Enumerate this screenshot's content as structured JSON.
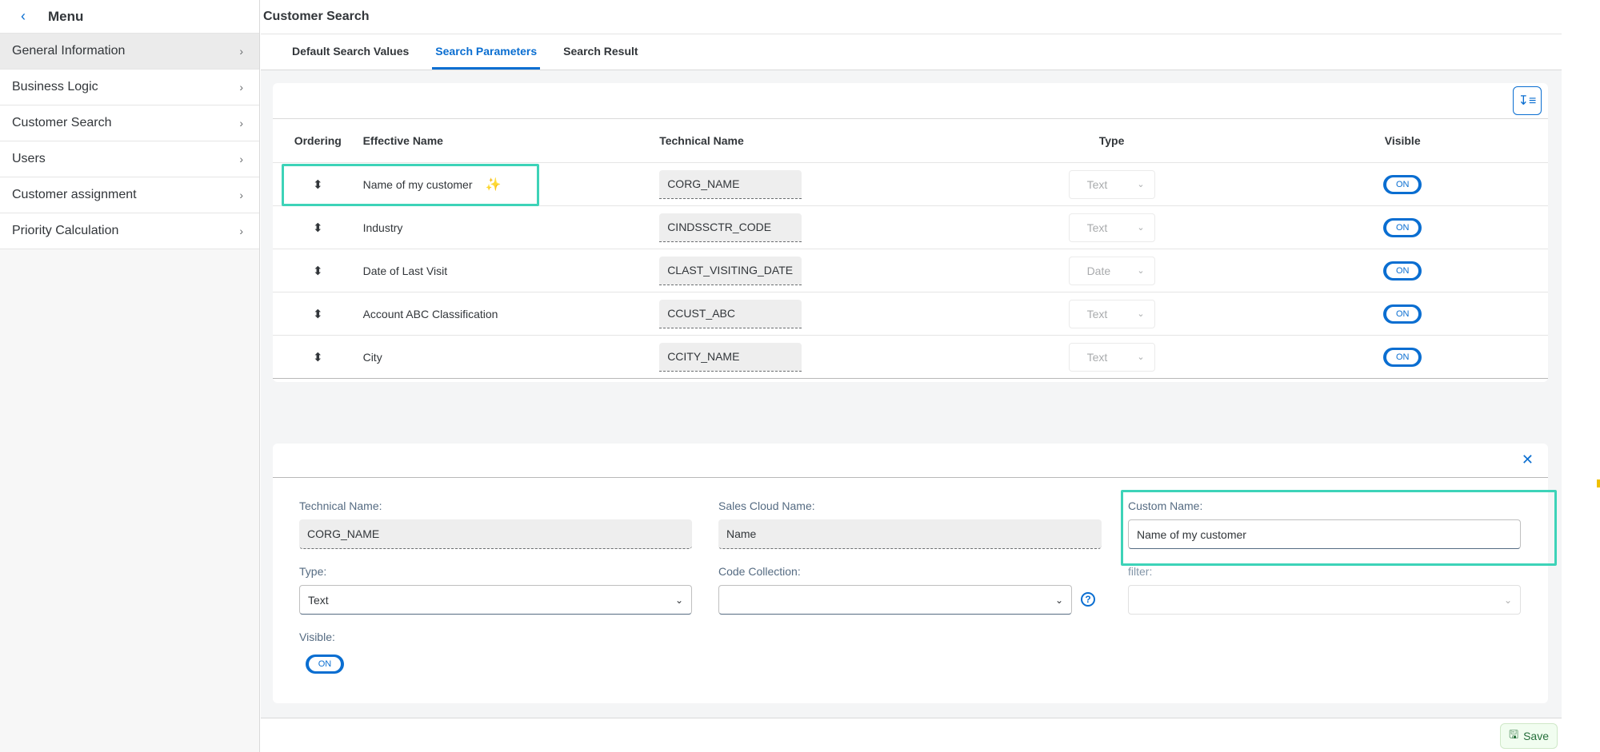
{
  "sidebar": {
    "back_icon": "chevron-left-icon",
    "title": "Menu",
    "items": [
      {
        "label": "General Information",
        "active": true
      },
      {
        "label": "Business Logic"
      },
      {
        "label": "Customer Search"
      },
      {
        "label": "Users"
      },
      {
        "label": "Customer assignment"
      },
      {
        "label": "Priority Calculation"
      }
    ]
  },
  "header": {
    "title": "Customer Search"
  },
  "tabs": [
    {
      "label": "Default Search Values"
    },
    {
      "label": "Search Parameters",
      "active": true
    },
    {
      "label": "Search Result"
    }
  ],
  "table": {
    "columns": {
      "ordering": "Ordering",
      "effective_name": "Effective Name",
      "technical_name": "Technical Name",
      "type": "Type",
      "visible": "Visible"
    },
    "rows": [
      {
        "effective_name": "Name of my customer",
        "technical_name": "CORG_NAME",
        "type": "Text",
        "visible": "ON",
        "customized": true
      },
      {
        "effective_name": "Industry",
        "technical_name": "CINDSSCTR_CODE",
        "type": "Text",
        "visible": "ON"
      },
      {
        "effective_name": "Date of Last Visit",
        "technical_name": "CLAST_VISITING_DATE",
        "type": "Date",
        "visible": "ON"
      },
      {
        "effective_name": "Account ABC Classification",
        "technical_name": "CCUST_ABC",
        "type": "Text",
        "visible": "ON"
      },
      {
        "effective_name": "City",
        "technical_name": "CCITY_NAME",
        "type": "Text",
        "visible": "ON"
      }
    ]
  },
  "detail": {
    "technical_name_label": "Technical Name:",
    "technical_name_value": "CORG_NAME",
    "sales_cloud_name_label": "Sales Cloud Name:",
    "sales_cloud_name_value": "Name",
    "custom_name_label": "Custom Name:",
    "custom_name_value": "Name of my customer",
    "type_label": "Type:",
    "type_value": "Text",
    "code_collection_label": "Code Collection:",
    "code_collection_value": "",
    "filter_label": "filter:",
    "filter_value": "",
    "visible_label": "Visible:",
    "visible_value": "ON",
    "help_glyph": "?"
  },
  "footer": {
    "save_label": "Save"
  },
  "colors": {
    "accent": "#0a6ed1",
    "highlight": "#3dd3b8",
    "save": "#256f3a"
  }
}
